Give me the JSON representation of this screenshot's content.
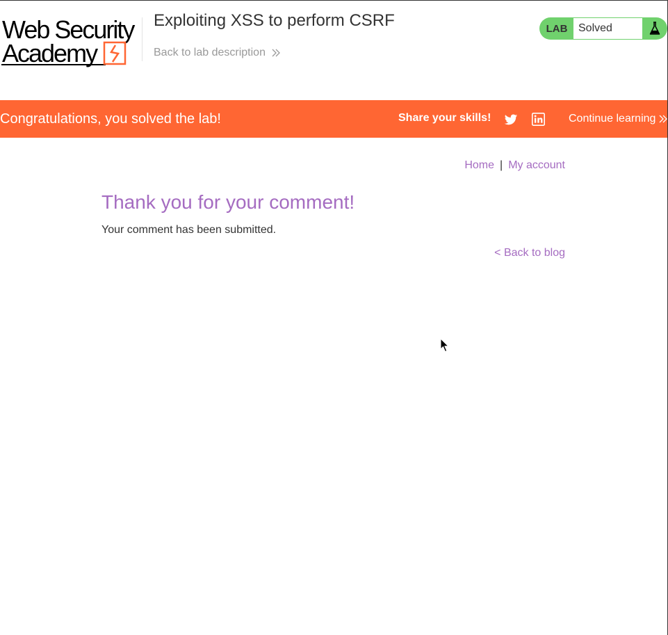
{
  "header": {
    "logo_line1": "Web Security",
    "logo_line2": "Academy",
    "lab_title": "Exploiting XSS to perform CSRF",
    "back_link": "Back to lab description",
    "status": {
      "label": "LAB",
      "state": "Solved",
      "icon": "flask-icon",
      "color": "#70d16d"
    }
  },
  "banner": {
    "message": "Congratulations, you solved the lab!",
    "share_label": "Share your skills!",
    "share_icons": [
      "twitter-icon",
      "linkedin-icon"
    ],
    "continue_label": "Continue learning",
    "color": "#ff6633"
  },
  "nav": {
    "home": "Home",
    "separator": "|",
    "my_account": "My account"
  },
  "main": {
    "heading": "Thank you for your comment!",
    "message": "Your comment has been submitted.",
    "back_to_blog": "< Back to blog",
    "accent_color": "#a56cc1"
  }
}
